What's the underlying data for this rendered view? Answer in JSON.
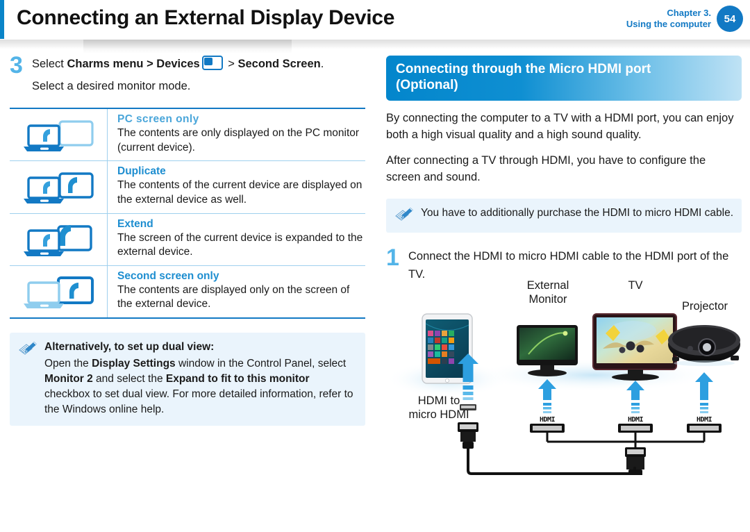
{
  "header": {
    "title": "Connecting an External Display Device",
    "chapter_line1": "Chapter 3.",
    "chapter_line2": "Using the computer",
    "page_number": "54",
    "accent_color": "#0a84c8"
  },
  "left_column": {
    "step": {
      "number": "3",
      "line1_pre": "Select ",
      "line1_b1": "Charms menu > Devices",
      "line1_icon": "devices-charm-icon",
      "line1_mid": " > ",
      "line1_b2": "Second Screen",
      "line1_post": ".",
      "line2": "Select a desired monitor mode."
    },
    "modes": [
      {
        "title": "PC screen only",
        "desc": "The contents are only displayed on the PC monitor (current device).",
        "icon": "laptop-active-monitor-inactive-icon"
      },
      {
        "title": "Duplicate",
        "desc": "The contents of the current device are displayed on the external device as well.",
        "icon": "laptop-active-monitor-active-icon"
      },
      {
        "title": "Extend",
        "desc": "The screen of the current device is expanded to the external device.",
        "icon": "laptop-active-monitor-extend-icon"
      },
      {
        "title": "Second screen only",
        "desc": "The contents are displayed only on the screen of the external device.",
        "icon": "laptop-inactive-monitor-active-icon"
      }
    ],
    "note": {
      "icon": "note-pencil-icon",
      "title": "Alternatively, to set up dual view:",
      "body_1": "Open the ",
      "body_b1": "Display Settings",
      "body_2": " window in the Control Panel, select ",
      "body_b2": "Monitor 2",
      "body_3": " and select the ",
      "body_b3": "Expand to fit to this monitor",
      "body_4": " checkbox to set dual view. For more detailed information, refer to the Windows online help."
    }
  },
  "right_column": {
    "section_title_line1": "Connecting through the Micro HDMI port",
    "section_title_line2": "(Optional)",
    "paragraph_1": "By connecting the computer to a TV with a HDMI port, you can enjoy both a high visual quality and a high sound quality.",
    "paragraph_2": "After connecting a TV through HDMI, you have to configure the screen and sound.",
    "note": {
      "icon": "note-pencil-icon",
      "text": "You have to additionally purchase the HDMI to micro HDMI cable."
    },
    "step": {
      "number": "1",
      "text": "Connect the HDMI to micro HDMI cable to the HDMI port of the TV."
    },
    "diagram": {
      "labels": {
        "external_monitor": "External\nMonitor",
        "tv": "TV",
        "projector": "Projector",
        "cable": "HDMI to\nmicro HDMI"
      },
      "external_monitor_l1": "External",
      "external_monitor_l2": "Monitor",
      "tv": "TV",
      "projector": "Projector",
      "cable_l1": "HDMI to",
      "cable_l2": "micro HDMI",
      "port_label": "HDMI",
      "devices": [
        "tablet",
        "external-monitor",
        "tv",
        "projector"
      ]
    }
  },
  "colors": {
    "brand_blue": "#1279c4",
    "light_blue": "#53b4e8",
    "pale_blue": "#9fd0ee",
    "note_bg": "#eaf4fc"
  }
}
